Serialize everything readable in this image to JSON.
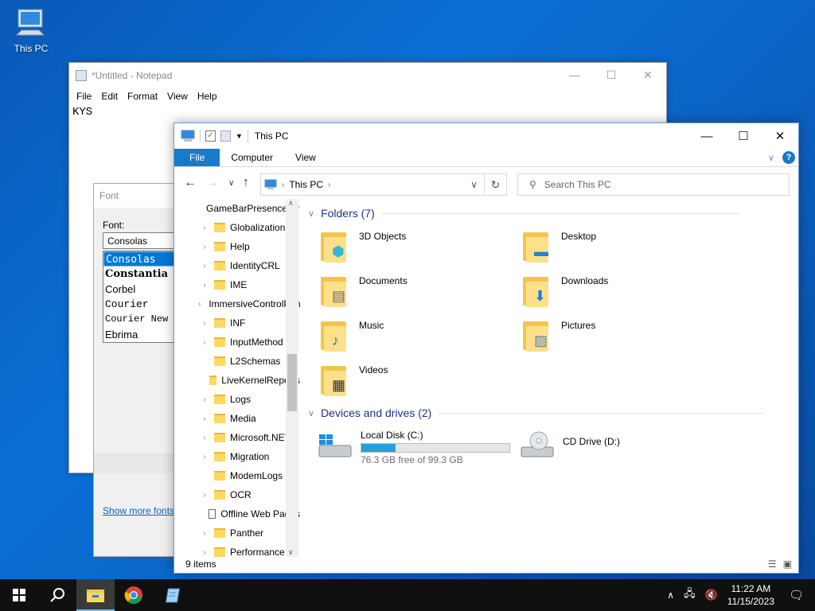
{
  "desktop": {
    "icon_label": "This PC"
  },
  "notepad": {
    "title": "*Untitled - Notepad",
    "menu": [
      "File",
      "Edit",
      "Format",
      "View",
      "Help"
    ],
    "content": "KYS"
  },
  "font_dialog": {
    "title": "Font",
    "font_label": "Font:",
    "font_value": "Consolas",
    "fonts": [
      "Consolas",
      "Constantia",
      "Corbel",
      "Courier",
      "Courier New",
      "Ebrima"
    ],
    "show_more": "Show more fonts"
  },
  "explorer": {
    "title": "This PC",
    "ribbon_tabs": [
      "File",
      "Computer",
      "View"
    ],
    "address": "This PC",
    "search_placeholder": "Search This PC",
    "nav_items": [
      {
        "label": "GameBarPresenceWriter",
        "expandable": false,
        "type": "folder"
      },
      {
        "label": "Globalization",
        "expandable": true,
        "type": "folder"
      },
      {
        "label": "Help",
        "expandable": true,
        "type": "folder"
      },
      {
        "label": "IdentityCRL",
        "expandable": true,
        "type": "folder"
      },
      {
        "label": "IME",
        "expandable": true,
        "type": "folder"
      },
      {
        "label": "ImmersiveControlPanel",
        "expandable": true,
        "type": "folder"
      },
      {
        "label": "INF",
        "expandable": true,
        "type": "folder"
      },
      {
        "label": "InputMethod",
        "expandable": true,
        "type": "folder"
      },
      {
        "label": "L2Schemas",
        "expandable": false,
        "type": "folder"
      },
      {
        "label": "LiveKernelReports",
        "expandable": false,
        "type": "folder"
      },
      {
        "label": "Logs",
        "expandable": true,
        "type": "folder"
      },
      {
        "label": "Media",
        "expandable": true,
        "type": "folder"
      },
      {
        "label": "Microsoft.NET",
        "expandable": true,
        "type": "folder"
      },
      {
        "label": "Migration",
        "expandable": true,
        "type": "folder"
      },
      {
        "label": "ModemLogs",
        "expandable": false,
        "type": "folder"
      },
      {
        "label": "OCR",
        "expandable": true,
        "type": "folder"
      },
      {
        "label": "Offline Web Pages",
        "expandable": false,
        "type": "system"
      },
      {
        "label": "Panther",
        "expandable": true,
        "type": "folder"
      },
      {
        "label": "Performance",
        "expandable": true,
        "type": "folder"
      }
    ],
    "folders_header": "Folders (7)",
    "folders": [
      {
        "label": "3D Objects",
        "emblem": "cube-icon",
        "glyph": "⬢",
        "color": "#35b7d8"
      },
      {
        "label": "Desktop",
        "emblem": "monitor-icon",
        "glyph": "▬",
        "color": "#1a86d8"
      },
      {
        "label": "Documents",
        "emblem": "document-icon",
        "glyph": "▤",
        "color": "#6a6a6a"
      },
      {
        "label": "Downloads",
        "emblem": "download-arrow-icon",
        "glyph": "⬇",
        "color": "#1f7fd6"
      },
      {
        "label": "Music",
        "emblem": "music-note-icon",
        "glyph": "♪",
        "color": "#1a73d0"
      },
      {
        "label": "Pictures",
        "emblem": "picture-icon",
        "glyph": "▨",
        "color": "#5a86b8"
      },
      {
        "label": "Videos",
        "emblem": "film-icon",
        "glyph": "▦",
        "color": "#333333"
      }
    ],
    "drives_header": "Devices and drives (2)",
    "drives": [
      {
        "label": "Local Disk (C:)",
        "free_text": "76.3 GB free of 99.3 GB",
        "used_fraction": 0.232
      },
      {
        "label": "CD Drive (D:)"
      }
    ],
    "status": "9 items"
  },
  "taskbar": {
    "time": "11:22 AM",
    "date": "11/15/2023"
  }
}
